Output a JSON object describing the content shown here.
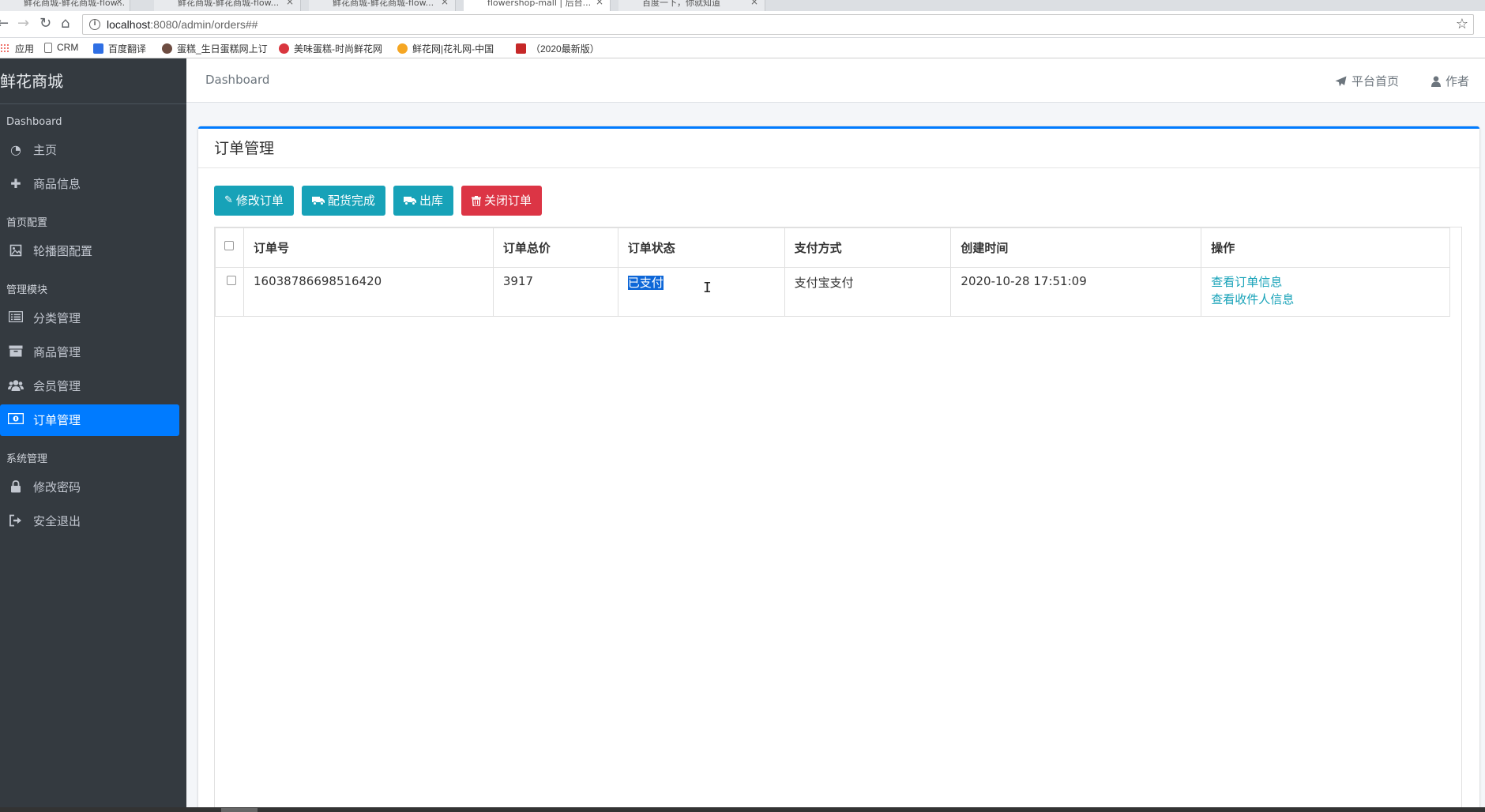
{
  "browser": {
    "tabs": [
      {
        "label": "鲜花商城-鲜花商城-flow..."
      },
      {
        "label": "鲜花商城-鲜花商城-flow..."
      },
      {
        "label": "鲜花商城-鲜花商城-flow..."
      },
      {
        "label": "flowershop-mall | 后台..."
      },
      {
        "label": "百度一下，你就知道"
      }
    ],
    "url_host": "localhost",
    "url_path": ":8080/admin/orders##",
    "bookmarks": [
      {
        "label": "应用",
        "color": "#e8453c"
      },
      {
        "label": "CRM",
        "color": "#9e9e9e"
      },
      {
        "label": "百度翻译",
        "color": "#2f6fe4"
      },
      {
        "label": "蛋糕_生日蛋糕网上订",
        "color": "#6d4c41"
      },
      {
        "label": "美味蛋糕-时尚鲜花网",
        "color": "#d9363e"
      },
      {
        "label": "鲜花网|花礼网-中国",
        "color": "#f5a623"
      },
      {
        "label": "（2020最新版）",
        "color": "#c62828"
      }
    ]
  },
  "sidebar": {
    "brand": "鲜花商城",
    "sections": [
      {
        "header": "Dashboard",
        "items": [
          {
            "label": "主页",
            "icon": "dashboard-icon"
          },
          {
            "label": "商品信息",
            "icon": "plus-icon"
          }
        ]
      },
      {
        "header": "首页配置",
        "items": [
          {
            "label": "轮播图配置",
            "icon": "image-icon"
          }
        ]
      },
      {
        "header": "管理模块",
        "items": [
          {
            "label": "分类管理",
            "icon": "list-icon"
          },
          {
            "label": "商品管理",
            "icon": "archive-icon"
          },
          {
            "label": "会员管理",
            "icon": "users-icon"
          },
          {
            "label": "订单管理",
            "icon": "money-icon",
            "active": true
          }
        ]
      },
      {
        "header": "系统管理",
        "items": [
          {
            "label": "修改密码",
            "icon": "lock-icon"
          },
          {
            "label": "安全退出",
            "icon": "sign-out-icon"
          }
        ]
      }
    ]
  },
  "topbar": {
    "breadcrumb": "Dashboard",
    "platform_home": "平台首页",
    "author": "作者"
  },
  "card": {
    "title": "订单管理",
    "buttons": {
      "edit": "修改订单",
      "delivered": "配货完成",
      "outbound": "出库",
      "close": "关闭订单"
    }
  },
  "table": {
    "headers": [
      "订单号",
      "订单总价",
      "订单状态",
      "支付方式",
      "创建时间",
      "操作"
    ],
    "rows": [
      {
        "order_no": "16038786698516420",
        "total": "3917",
        "status": "已支付",
        "pay_method": "支付宝支付",
        "created": "2020-10-28 17:51:09",
        "action_view_order": "查看订单信息",
        "action_view_receiver": "查看收件人信息"
      }
    ]
  },
  "colors": {
    "sidebar_bg": "#343a40",
    "accent": "#007bff",
    "info": "#17a2b8",
    "danger": "#dc3545"
  }
}
